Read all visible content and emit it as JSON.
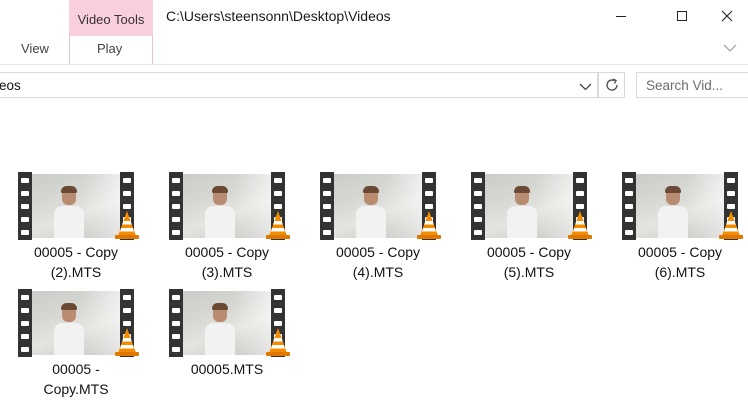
{
  "window": {
    "title": "C:\\Users\\steensonn\\Desktop\\Videos",
    "context_tab_header": "Video Tools",
    "tabs": [
      "View",
      "Play"
    ]
  },
  "address": {
    "path_text": "eos"
  },
  "search": {
    "placeholder": "Search Vid..."
  },
  "files": [
    {
      "name_line1": "00005 - Copy",
      "name_line2": "(2).MTS"
    },
    {
      "name_line1": "00005 - Copy",
      "name_line2": "(3).MTS"
    },
    {
      "name_line1": "00005 - Copy",
      "name_line2": "(4).MTS"
    },
    {
      "name_line1": "00005 - Copy",
      "name_line2": "(5).MTS"
    },
    {
      "name_line1": "00005 - Copy",
      "name_line2": "(6).MTS"
    },
    {
      "name_line1": "00005 -",
      "name_line2": "Copy.MTS"
    },
    {
      "name_line1": "00005.MTS",
      "name_line2": ""
    }
  ],
  "icons": {
    "file_thumbnail": "video-film-strip-icon",
    "overlay": "vlc-cone-icon"
  },
  "colors": {
    "context_tab": "#f9cfe0",
    "vlc_orange": "#f28c00"
  }
}
